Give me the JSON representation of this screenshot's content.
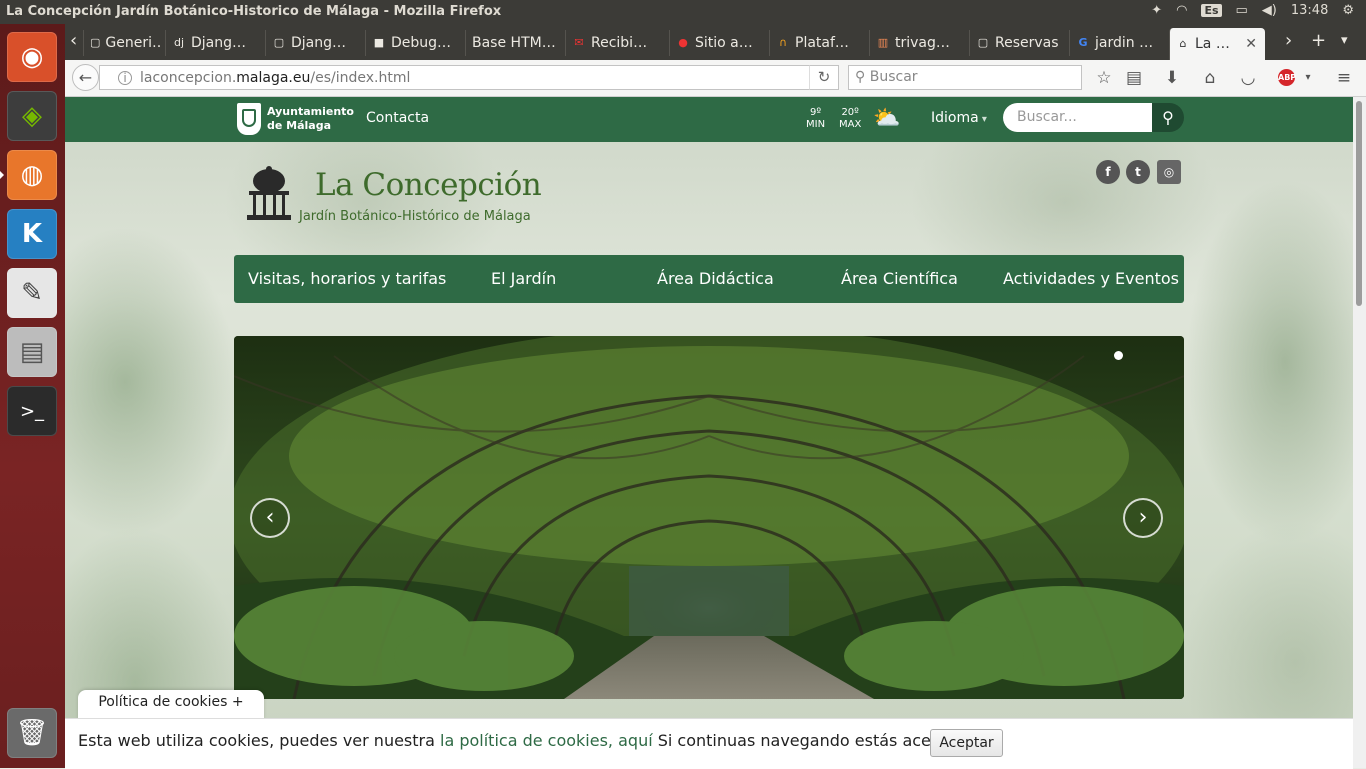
{
  "os": {
    "window_title": "La Concepción Jardín Botánico-Historico de Málaga - Mozilla Firefox",
    "keyboard_layout": "Es",
    "clock": "13:48"
  },
  "launcher": {
    "items": [
      "ubuntu-icon",
      "nvidia-icon",
      "firefox-icon",
      "kde-connect-icon",
      "text-editor-icon",
      "file-manager-icon",
      "terminal-icon",
      "trash-icon"
    ]
  },
  "browser": {
    "tabs": [
      {
        "label": "Generi…"
      },
      {
        "label": "Djang…"
      },
      {
        "label": "Djang…"
      },
      {
        "label": "Debug…"
      },
      {
        "label": "Base HTM…"
      },
      {
        "label": "Recibi…"
      },
      {
        "label": "Sitio a…"
      },
      {
        "label": "Plataf…"
      },
      {
        "label": "trivag…"
      },
      {
        "label": "Reservas"
      },
      {
        "label": "jardin …"
      },
      {
        "label": "La …"
      }
    ],
    "url_domain_pre": "laconcepcion.",
    "url_domain": "malaga.eu",
    "url_path": "/es/index.html",
    "search_placeholder": "Buscar"
  },
  "site": {
    "header": {
      "ayto_line1": "Ayuntamiento",
      "ayto_line2": "de Málaga",
      "contact": "Contacta",
      "temp_min_value": "9º",
      "temp_min_label": "MIN",
      "temp_max_value": "20º",
      "temp_max_label": "MAX",
      "language": "Idioma",
      "search_placeholder": "Buscar..."
    },
    "logo": {
      "name": "La Concepción",
      "subtitle": "Jardín Botánico-Histórico de Málaga"
    },
    "social": [
      "facebook-icon",
      "twitter-icon",
      "instagram-icon"
    ],
    "nav": [
      {
        "label": "Visitas, horarios y tarifas"
      },
      {
        "label": "El Jardín"
      },
      {
        "label": "Área Didáctica"
      },
      {
        "label": "Área Científica"
      },
      {
        "label": "Actividades y Eventos"
      }
    ],
    "carousel": {
      "slide_count": 1,
      "active_index": 0
    },
    "cookies": {
      "tab_label": "Política de cookies +",
      "message_pre": "Esta web utiliza cookies, puedes ver nuestra ",
      "link_text": "la política de cookies, aquí",
      "message_post": " Si continuas navegando estás aceptándola",
      "accept_label": "Aceptar"
    }
  }
}
